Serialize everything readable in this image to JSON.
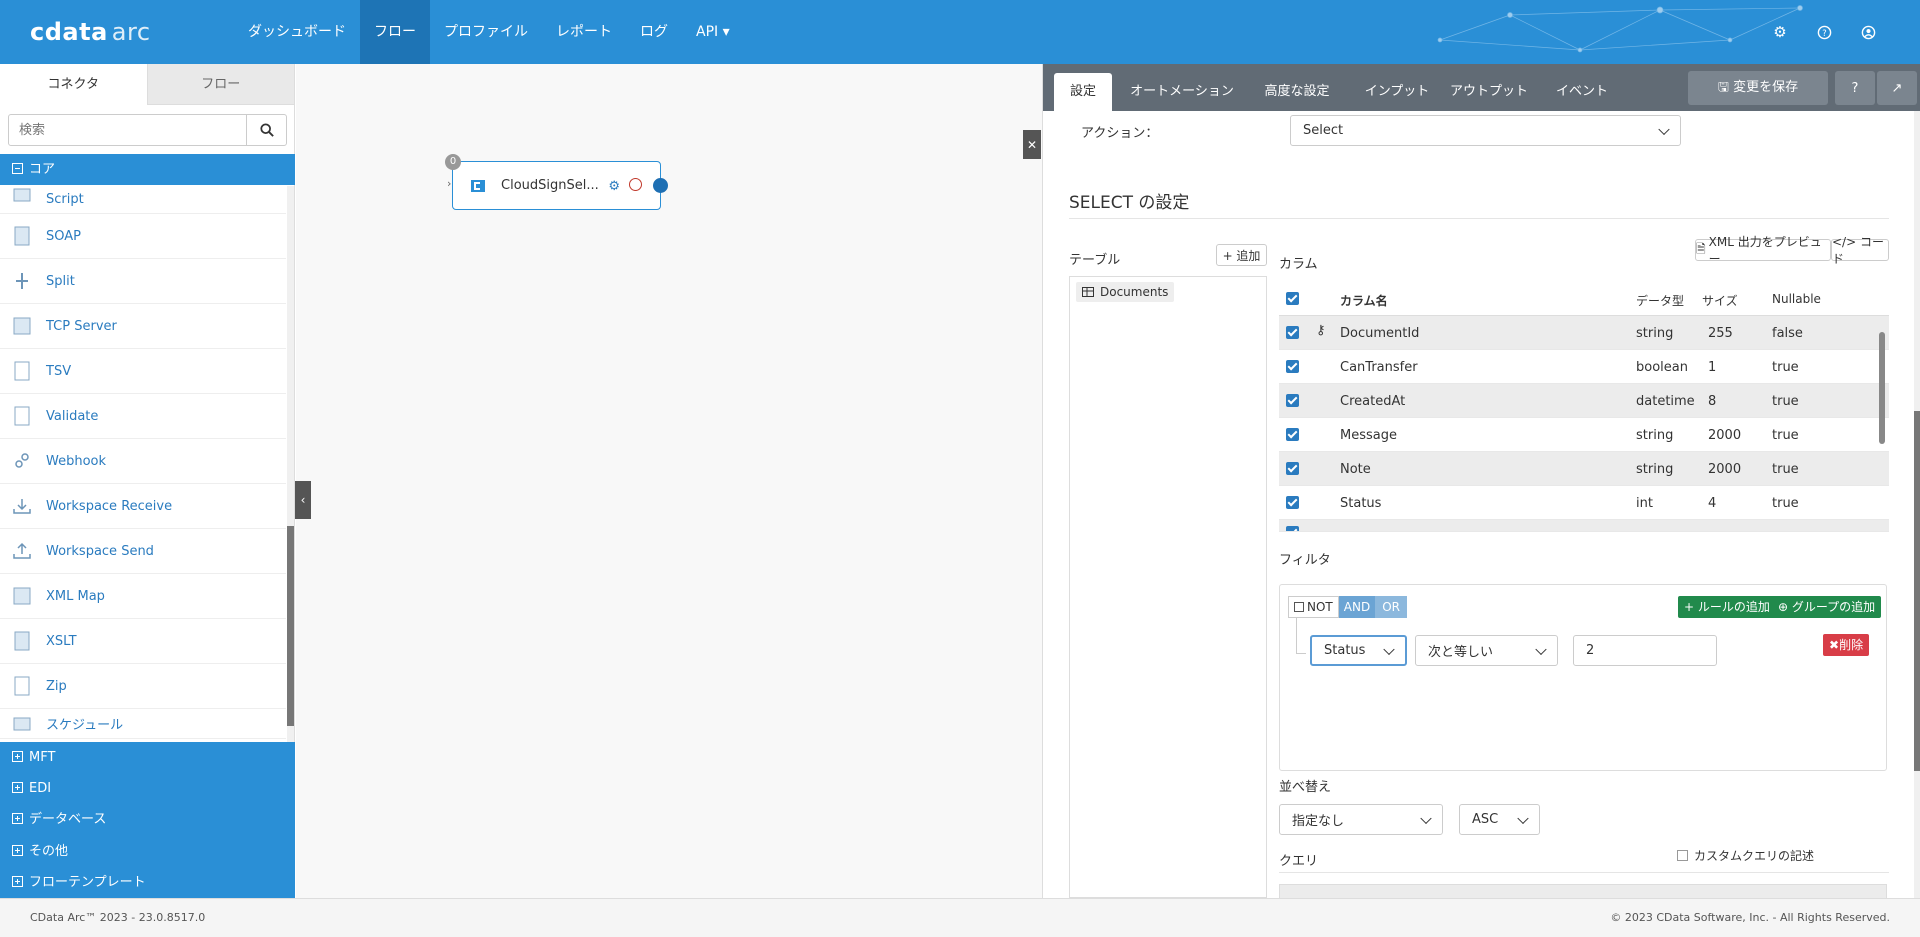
{
  "app": {
    "logo_main": "cdata",
    "logo_sub": "arc"
  },
  "nav": [
    "ダッシュボード",
    "フロー",
    "プロファイル",
    "レポート",
    "ログ",
    "API ▾"
  ],
  "top_icons": [
    "gear-icon",
    "help-icon",
    "user-icon"
  ],
  "left": {
    "tabs": [
      "コネクタ",
      "フロー"
    ],
    "search_placeholder": "検索",
    "core_label": "コア",
    "connectors": [
      "Script",
      "SOAP",
      "Split",
      "TCP Server",
      "TSV",
      "Validate",
      "Webhook",
      "Workspace Receive",
      "Workspace Send",
      "XML Map",
      "XSLT",
      "Zip",
      "スケジュール"
    ],
    "categories": [
      "MFT",
      "EDI",
      "データベース",
      "その他",
      "フローテンプレート"
    ]
  },
  "node": {
    "badge": "0",
    "title": "CloudSignSel..."
  },
  "right": {
    "tabs": [
      "設定",
      "オートメーション",
      "高度な設定",
      "インプット",
      "アウトプット",
      "イベント"
    ],
    "save_label": "変更を保存",
    "action_label": "アクション：",
    "action_value": "Select",
    "section_title": "SELECT の設定",
    "table_label": "テーブル",
    "add_label": "+ 追加",
    "table_item": "Documents",
    "columns_label": "カラム",
    "preview_label": "XML 出力をプレビュー",
    "code_label": "</> コード",
    "grid_headers": [
      "カラム名",
      "データ型",
      "サイズ",
      "Nullable"
    ],
    "rows": [
      {
        "name": "DocumentId",
        "type": "string",
        "size": "255",
        "nullable": "false"
      },
      {
        "name": "CanTransfer",
        "type": "boolean",
        "size": "1",
        "nullable": "true"
      },
      {
        "name": "CreatedAt",
        "type": "datetime",
        "size": "8",
        "nullable": "true"
      },
      {
        "name": "Message",
        "type": "string",
        "size": "2000",
        "nullable": "true"
      },
      {
        "name": "Note",
        "type": "string",
        "size": "2000",
        "nullable": "true"
      },
      {
        "name": "Status",
        "type": "int",
        "size": "4",
        "nullable": "true"
      }
    ],
    "filter_label": "フィルタ",
    "not_label": "NOT",
    "and_label": "AND",
    "or_label": "OR",
    "add_rule_label": "ルールの追加",
    "add_group_label": "グループの追加",
    "rule_field": "Status",
    "rule_operator": "次と等しい",
    "rule_value": "2",
    "delete_label": "削除",
    "sort_label": "並べ替え",
    "sort_value": "指定なし",
    "sort_dir": "ASC",
    "query_label": "クエリ",
    "custom_query_label": "カスタムクエリの記述"
  },
  "footer": {
    "left": "CData Arc™ 2023 - 23.0.8517.0",
    "right": "© 2023 CData Software, Inc. - All Rights Reserved."
  },
  "colors": {
    "brand": "#2a8fd6",
    "tabbar": "#616b75",
    "green": "#218a4c",
    "red": "#d83d47"
  }
}
